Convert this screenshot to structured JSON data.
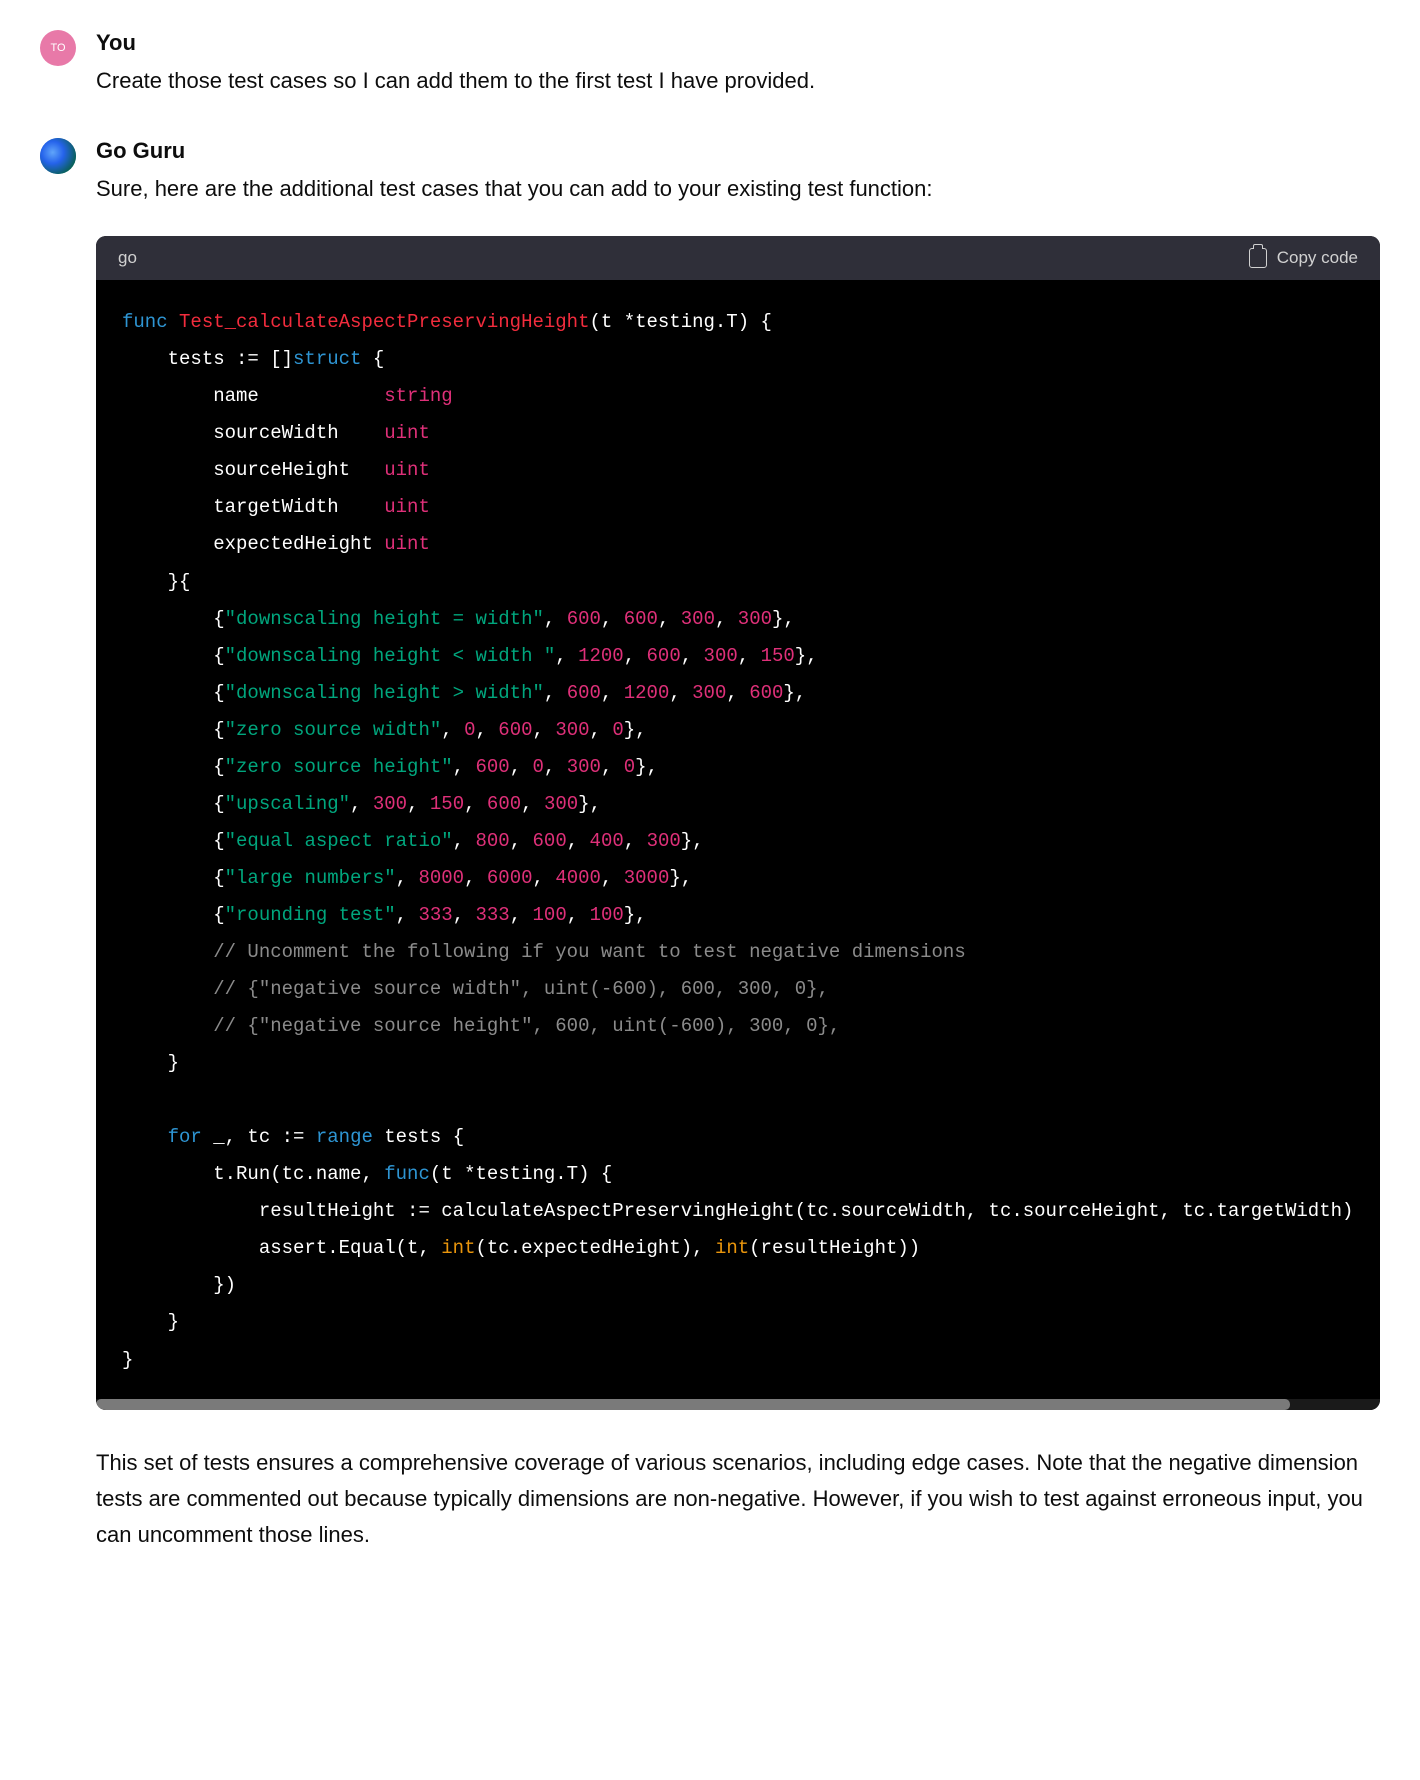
{
  "user": {
    "avatar_text": "TO",
    "name": "You",
    "message": "Create those test cases so I can add them to the first test I have provided."
  },
  "assistant": {
    "name": "Go Guru",
    "intro": "Sure, here are the additional test cases that you can add to your existing test function:",
    "followup": "This set of tests ensures a comprehensive coverage of various scenarios, including edge cases. Note that the negative dimension tests are commented out because typically dimensions are non-negative. However, if you wish to test against erroneous input, you can uncomment those lines."
  },
  "code": {
    "language": "go",
    "copy_label": "Copy code",
    "tokens": {
      "func": "func",
      "fn_name": "Test_calculateAspectPreservingHeight",
      "sig_rest": "(t *testing.T) {",
      "l_tests": "    tests := []",
      "struct": "struct",
      "l_struct_open": " {",
      "f_name": "        name           ",
      "t_string": "string",
      "f_sw": "        sourceWidth    ",
      "f_sh": "        sourceHeight   ",
      "f_tw": "        targetWidth    ",
      "f_eh": "        expectedHeight ",
      "t_uint": "uint",
      "l_close_struct": "    }{",
      "rows": [
        {
          "s": "\"downscaling height = width\"",
          "n": [
            "600",
            "600",
            "300",
            "300"
          ]
        },
        {
          "s": "\"downscaling height < width \"",
          "n": [
            "1200",
            "600",
            "300",
            "150"
          ]
        },
        {
          "s": "\"downscaling height > width\"",
          "n": [
            "600",
            "1200",
            "300",
            "600"
          ]
        },
        {
          "s": "\"zero source width\"",
          "n": [
            "0",
            "600",
            "300",
            "0"
          ]
        },
        {
          "s": "\"zero source height\"",
          "n": [
            "600",
            "0",
            "300",
            "0"
          ]
        },
        {
          "s": "\"upscaling\"",
          "n": [
            "300",
            "150",
            "600",
            "300"
          ]
        },
        {
          "s": "\"equal aspect ratio\"",
          "n": [
            "800",
            "600",
            "400",
            "300"
          ]
        },
        {
          "s": "\"large numbers\"",
          "n": [
            "8000",
            "6000",
            "4000",
            "3000"
          ]
        },
        {
          "s": "\"rounding test\"",
          "n": [
            "333",
            "333",
            "100",
            "100"
          ]
        }
      ],
      "c1": "        // Uncomment the following if you want to test negative dimensions",
      "c2": "        // {\"negative source width\", uint(-600), 600, 300, 0},",
      "c3": "        // {\"negative source height\", 600, uint(-600), 300, 0},",
      "l_close_slice": "    }",
      "for": "for",
      "l_for_rest1": " _, tc := ",
      "range": "range",
      "l_for_rest2": " tests {",
      "l_trun1": "        t.Run(tc.name, ",
      "l_trun2": "(t *testing.T) {",
      "l_result": "            resultHeight := calculateAspectPreservingHeight(tc.sourceWidth, tc.sourceHeight, tc.targetWidth)",
      "l_assert1": "            assert.Equal(t, ",
      "int": "int",
      "l_assert2": "(tc.expectedHeight), ",
      "l_assert3": "(resultHeight))",
      "l_close_fn": "        })",
      "l_close_for": "    }",
      "l_close_func": "}"
    }
  }
}
